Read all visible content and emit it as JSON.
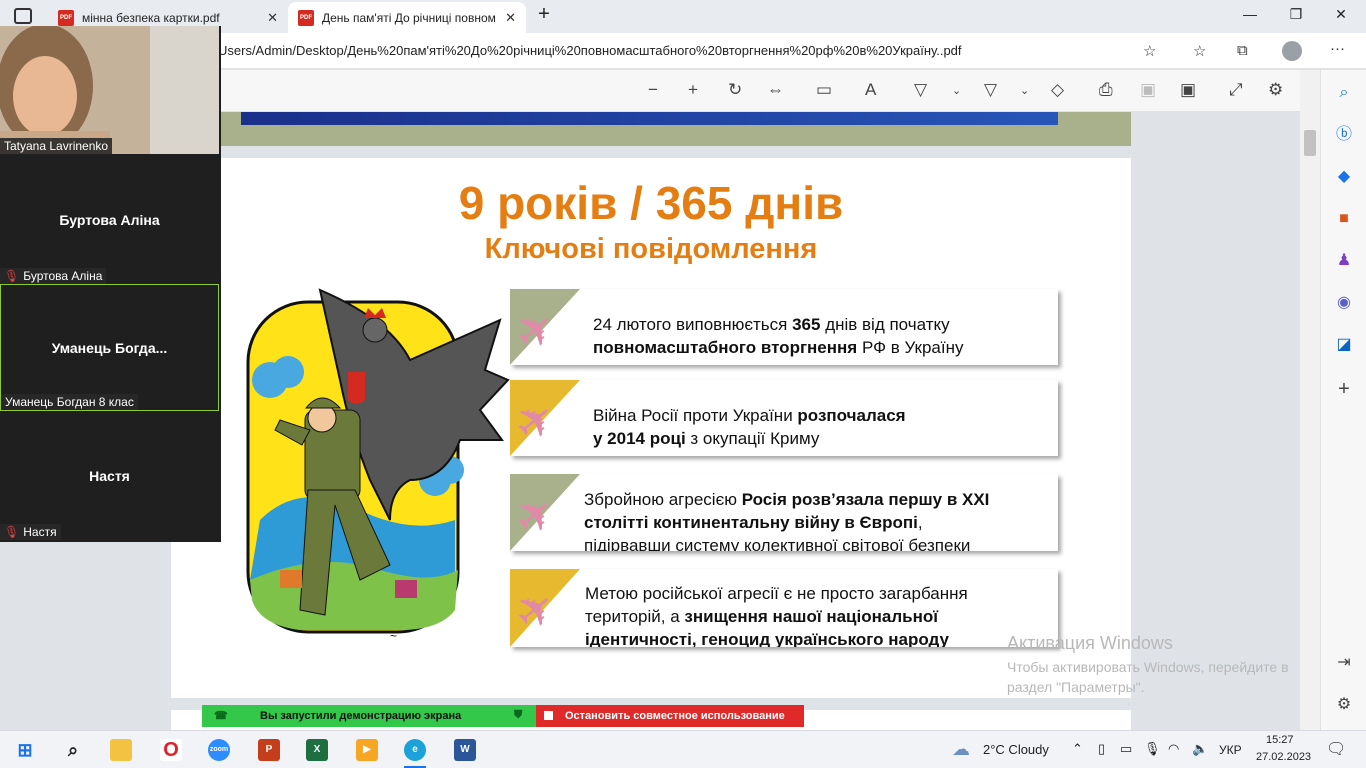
{
  "tabs": [
    {
      "label": "мінна безпека картки.pdf"
    },
    {
      "label": "День пам'яті До річниці повном"
    }
  ],
  "address": {
    "url": "Users/Admin/Desktop/День%20пам'яті%20До%20річниці%20повномасштабного%20вторгнення%20рф%20в%20Україну..pdf"
  },
  "slide": {
    "title": "9 років / 365 днів",
    "subtitle": "Ключові повідомлення",
    "cards": [
      {
        "parts": [
          [
            "24 лютого виповнюється ",
            false
          ],
          [
            "365",
            true
          ],
          [
            " днів від початку",
            false
          ],
          [
            "\n",
            false
          ],
          [
            "повномасштабного вторгнення",
            true
          ],
          [
            " РФ в Україну",
            false
          ]
        ]
      },
      {
        "parts": [
          [
            "Війна Росії проти України ",
            false
          ],
          [
            "розпочалася",
            true
          ],
          [
            "\n",
            false
          ],
          [
            "у 2014 році",
            true
          ],
          [
            " з окупації Криму",
            false
          ]
        ]
      },
      {
        "parts": [
          [
            "Збройною агресією ",
            false
          ],
          [
            "Росія розв’язала першу в XXI",
            true
          ],
          [
            "\n",
            false
          ],
          [
            "столітті континентальну війну в Європі",
            true
          ],
          [
            ",",
            false
          ],
          [
            "\n",
            false
          ],
          [
            "підірвавши систему колективної світової безпеки",
            false
          ]
        ]
      },
      {
        "parts": [
          [
            "Метою російської агресії є не просто загарбання",
            false
          ],
          [
            "\n",
            false
          ],
          [
            "територій, а ",
            false
          ],
          [
            "знищення нашої національної",
            true
          ],
          [
            "\n",
            false
          ],
          [
            "ідентичності, геноцид українського народу",
            true
          ]
        ]
      }
    ]
  },
  "zoom": {
    "participants": [
      {
        "name": "Tatyana Lavrinenko",
        "display": ""
      },
      {
        "name": "Буртова Аліна",
        "display": "Буртова Аліна"
      },
      {
        "name": "Уманець Богдан 8 клас",
        "display": "Уманець  Богда..."
      },
      {
        "name": "Настя",
        "display": "Настя"
      }
    ]
  },
  "share": {
    "status": "Вы запустили демонстрацию экрана",
    "stop": "Остановить совместное использование"
  },
  "watermark": {
    "title": "Активация Windows",
    "line": "Чтобы активировать Windows, перейдите в раздел \"Параметры\"."
  },
  "taskbar": {
    "weather": "2°C  Cloudy",
    "lang": "УКР",
    "time": "15:27",
    "date": "27.02.2023"
  },
  "colors": {
    "accent_orange": "#e57e12",
    "card_green": "#a8b08c",
    "card_yellow": "#e6b92e",
    "plane_pink": "#e08aa8"
  }
}
